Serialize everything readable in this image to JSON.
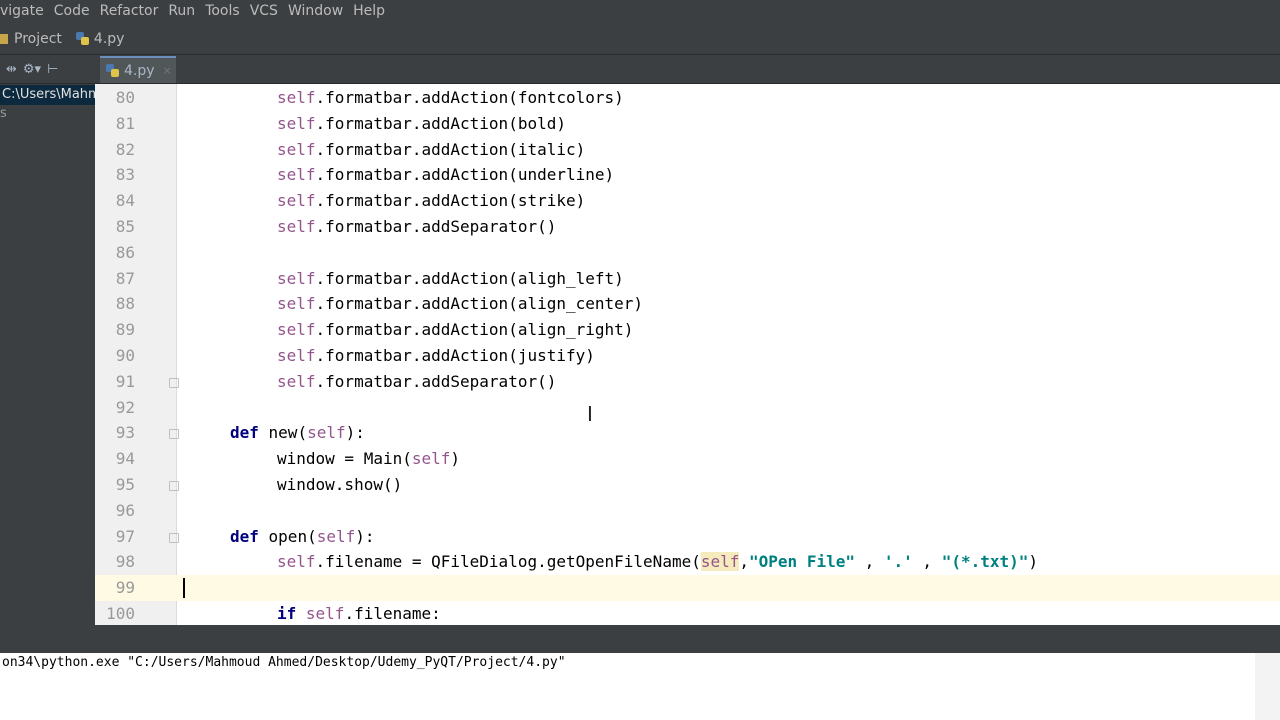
{
  "menu": [
    "vigate",
    "Code",
    "Refactor",
    "Run",
    "Tools",
    "VCS",
    "Window",
    "Help"
  ],
  "navbar": {
    "project": "Project",
    "file": "4.py"
  },
  "tab": {
    "label": "4.py"
  },
  "sidebar": {
    "selected": "C:\\Users\\Mahm",
    "item2": "s"
  },
  "editor": {
    "lines": [
      {
        "n": "80",
        "code": [
          [
            "self",
            "self"
          ],
          [
            "",
            "."
          ],
          [
            "",
            "formatbar.addAction(fontcolors)"
          ]
        ]
      },
      {
        "n": "81",
        "code": [
          [
            "self",
            "self"
          ],
          [
            "",
            ".formatbar.addAction(bold)"
          ]
        ]
      },
      {
        "n": "82",
        "code": [
          [
            "self",
            "self"
          ],
          [
            "",
            ".formatbar.addAction(italic)"
          ]
        ]
      },
      {
        "n": "83",
        "code": [
          [
            "self",
            "self"
          ],
          [
            "",
            ".formatbar.addAction(underline)"
          ]
        ]
      },
      {
        "n": "84",
        "code": [
          [
            "self",
            "self"
          ],
          [
            "",
            ".formatbar.addAction(strike)"
          ]
        ]
      },
      {
        "n": "85",
        "code": [
          [
            "self",
            "self"
          ],
          [
            "",
            ".formatbar.addSeparator()"
          ]
        ]
      },
      {
        "n": "86",
        "code": []
      },
      {
        "n": "87",
        "code": [
          [
            "self",
            "self"
          ],
          [
            "",
            ".formatbar.addAction(aligh_left)"
          ]
        ]
      },
      {
        "n": "88",
        "code": [
          [
            "self",
            "self"
          ],
          [
            "",
            ".formatbar.addAction(align_center)"
          ]
        ]
      },
      {
        "n": "89",
        "code": [
          [
            "self",
            "self"
          ],
          [
            "",
            ".formatbar.addAction(align_right)"
          ]
        ]
      },
      {
        "n": "90",
        "code": [
          [
            "self",
            "self"
          ],
          [
            "",
            ".formatbar.addAction(justify)"
          ]
        ]
      },
      {
        "n": "91",
        "code": [
          [
            "self",
            "self"
          ],
          [
            "",
            ".formatbar.addSeparator()"
          ]
        ]
      },
      {
        "n": "92",
        "code": []
      },
      {
        "n": "93",
        "code": [
          [
            "kw",
            "def"
          ],
          [
            "",
            " new("
          ],
          [
            "self",
            "self"
          ],
          [
            "",
            "):"
          ]
        ],
        "indent": 1
      },
      {
        "n": "94",
        "code": [
          [
            "",
            "window = Main("
          ],
          [
            "self",
            "self"
          ],
          [
            "",
            ")"
          ]
        ]
      },
      {
        "n": "95",
        "code": [
          [
            "",
            "window.show()"
          ]
        ]
      },
      {
        "n": "96",
        "code": []
      },
      {
        "n": "97",
        "code": [
          [
            "kw",
            "def"
          ],
          [
            "",
            " open("
          ],
          [
            "self",
            "self"
          ],
          [
            "",
            "):"
          ]
        ],
        "indent": 1
      },
      {
        "n": "98",
        "code": [
          [
            "self",
            "self"
          ],
          [
            "",
            ".filename = QFileDialog.getOpenFileName("
          ],
          [
            "hl",
            "self"
          ],
          [
            "",
            ","
          ],
          [
            "str",
            "\"OPen File\""
          ],
          [
            "",
            " , "
          ],
          [
            "str",
            "'.'"
          ],
          [
            "",
            " , "
          ],
          [
            "str",
            "\"(*.txt)\""
          ],
          [
            "",
            ")"
          ]
        ]
      },
      {
        "n": "99",
        "code": [],
        "current": true
      },
      {
        "n": "100",
        "code": [
          [
            "kw",
            "if"
          ],
          [
            "",
            " "
          ],
          [
            "self",
            "self"
          ],
          [
            "",
            ".filename:"
          ]
        ]
      }
    ]
  },
  "console": {
    "text": "on34\\python.exe \"C:/Users/Mahmoud Ahmed/Desktop/Udemy_PyQT/Project/4.py\""
  }
}
